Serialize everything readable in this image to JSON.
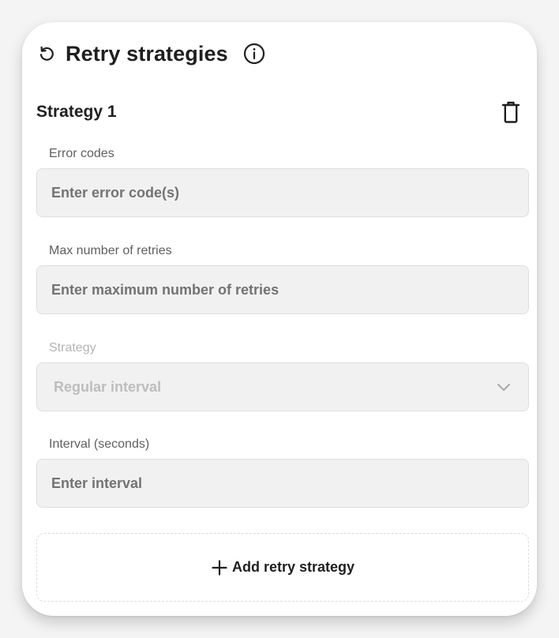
{
  "panel": {
    "title": "Retry strategies",
    "icons": {
      "retry": "counterclockwise-arrow-icon",
      "info": "info-circle-icon"
    }
  },
  "strategy": {
    "name": "Strategy 1",
    "delete_icon": "trash-icon",
    "fields": {
      "error_codes": {
        "label": "Error codes",
        "value": "",
        "placeholder": "Enter error code(s)"
      },
      "max_retries": {
        "label": "Max number of retries",
        "value": "",
        "placeholder": "Enter maximum number of retries"
      },
      "strategy_type": {
        "label": "Strategy",
        "selected": "Regular interval",
        "disabled": true,
        "icon": "chevron-down-icon"
      },
      "interval": {
        "label": "Interval (seconds)",
        "value": "",
        "placeholder": "Enter interval"
      }
    }
  },
  "add_button": {
    "label": "Add retry strategy",
    "icon": "plus-icon"
  },
  "colors": {
    "text": "#1f1f1f",
    "label": "#5f5f5f",
    "label_disabled": "#b4b4b4",
    "input_bg": "#f1f1f1",
    "input_border": "#dedede",
    "placeholder": "#737373",
    "disabled_value": "#bdbdbd"
  }
}
